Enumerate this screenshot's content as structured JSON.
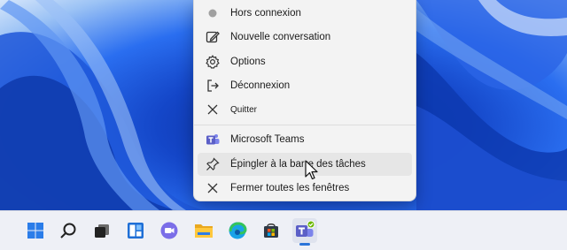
{
  "context_menu": {
    "items": [
      {
        "label": "Hors connexion",
        "icon": "status-dot-icon"
      },
      {
        "label": "Nouvelle conversation",
        "icon": "compose-icon"
      },
      {
        "label": "Options",
        "icon": "gear-icon"
      },
      {
        "label": "Déconnexion",
        "icon": "sign-out-icon"
      },
      {
        "label": "Quitter",
        "icon": "close-icon"
      },
      {
        "label": "Microsoft Teams",
        "icon": "teams-icon"
      },
      {
        "label": "Épingler à la barre des tâches",
        "icon": "pin-icon"
      },
      {
        "label": "Fermer toutes les fenêtres",
        "icon": "close-icon"
      }
    ],
    "hovered_index": 6
  },
  "taskbar": {
    "icons": [
      "windows-start-icon",
      "search-icon",
      "task-view-icon",
      "widgets-icon",
      "teams-chat-icon",
      "file-explorer-icon",
      "edge-browser-icon",
      "store-icon",
      "teams-app-icon"
    ],
    "active_icon": "teams-app-icon"
  },
  "colors": {
    "wallpaper_blue": "#1446c8",
    "accent": "#2b74d9",
    "teams_purple": "#5b5fc7",
    "status_green": "#6bb700"
  }
}
